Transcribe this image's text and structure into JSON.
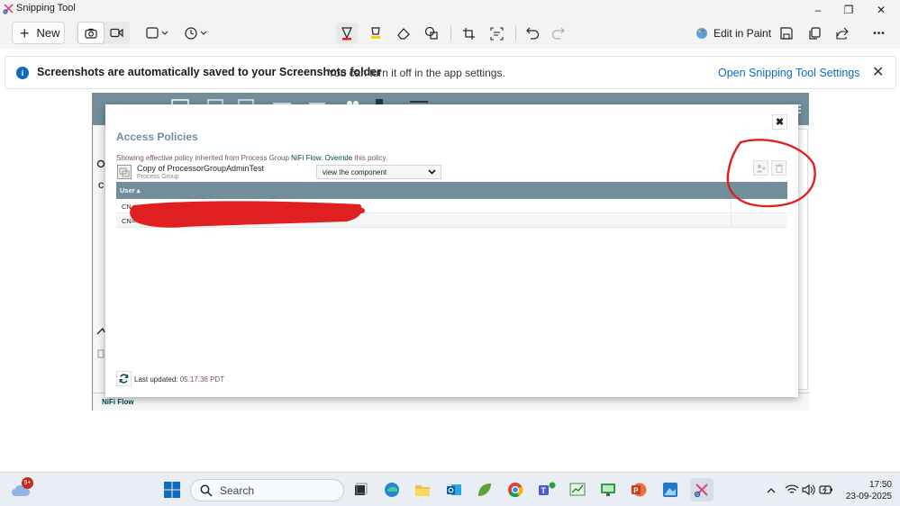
{
  "window": {
    "title": "Snipping Tool",
    "minimize": "–",
    "maximize": "❐",
    "close": "✕"
  },
  "toolbar": {
    "new_label": "New",
    "edit_in_paint_label": "Edit in Paint",
    "more_label": "•••"
  },
  "notification": {
    "title": "Screenshots are automatically saved to your Screenshots folder",
    "message": "You can turn it off in the app settings.",
    "link": "Open Snipping Tool Settings",
    "close": "✕"
  },
  "captured": {
    "breadcrumb": "NiFi Flow",
    "dialog": {
      "title": "Access Policies",
      "desc_prefix": "Showing effective policy inherited from Process Group ",
      "desc_link": "NiFi Flow",
      "desc_mid": ". ",
      "override_link": "Override",
      "desc_suffix": " this policy.",
      "component_name": "Copy of ProcessorGroupAdminTest",
      "component_type": "Process Group",
      "action_selected": "view the component",
      "close": "✖",
      "table": {
        "header": "User ▴",
        "rows": [
          {
            "user": "CN"
          },
          {
            "user": "CN="
          }
        ]
      },
      "last_updated_label": "Last updated:",
      "last_updated_time": "05:17:36 PDT"
    }
  },
  "colors": {
    "nifi_header": "#728e9b",
    "accent": "#0f6cbd",
    "annotation_red": "#e02020"
  },
  "taskbar": {
    "search_placeholder": "Search",
    "notification_count": "9+",
    "time": "17:50",
    "date": "23-09-2025"
  }
}
